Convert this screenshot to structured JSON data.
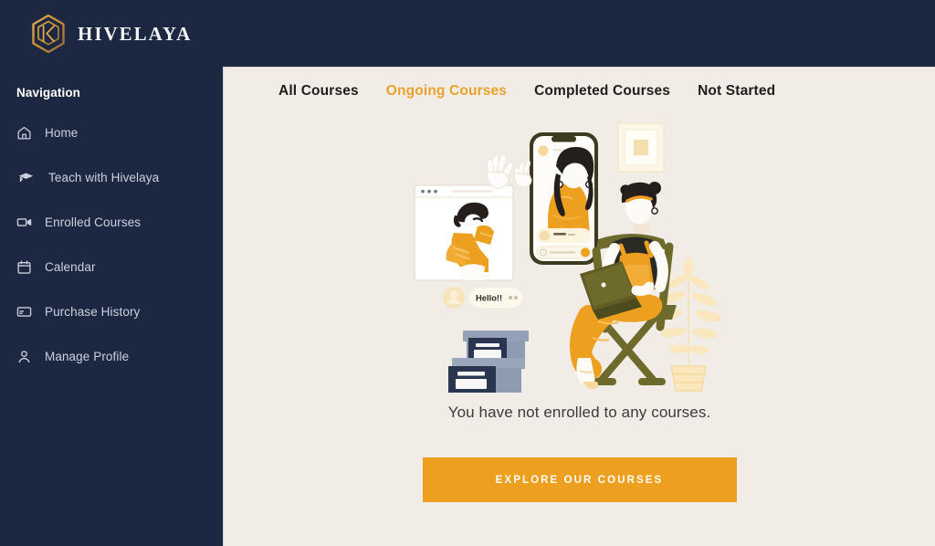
{
  "brand": {
    "name": "HIVELAYA",
    "logo_icon": "hexagon-hive-logo-icon",
    "logo_color": "#c8892f"
  },
  "sidebar": {
    "title": "Navigation",
    "background_color": "#1c2742",
    "items": [
      {
        "label": "Home",
        "icon": "home-icon"
      },
      {
        "label": "Teach with Hivelaya",
        "icon": "graduation-cap-icon"
      },
      {
        "label": "Enrolled Courses",
        "icon": "video-camera-icon"
      },
      {
        "label": "Calendar",
        "icon": "calendar-icon"
      },
      {
        "label": "Purchase History",
        "icon": "credit-card-icon"
      },
      {
        "label": "Manage Profile",
        "icon": "user-icon"
      }
    ]
  },
  "main": {
    "background_color": "#f1ece6",
    "accent_color": "#eda01f",
    "tabs": [
      {
        "label": "All Courses",
        "active": false
      },
      {
        "label": "Ongoing Courses",
        "active": true
      },
      {
        "label": "Completed Courses",
        "active": false
      },
      {
        "label": "Not Started",
        "active": false
      }
    ],
    "empty_state": {
      "illustration_name": "remote-learning-video-call-illustration",
      "illustration_chat_bubble_text": "Hello!!",
      "message": "You have not enrolled to any courses.",
      "cta_label": "EXPLORE OUR COURSES"
    }
  }
}
